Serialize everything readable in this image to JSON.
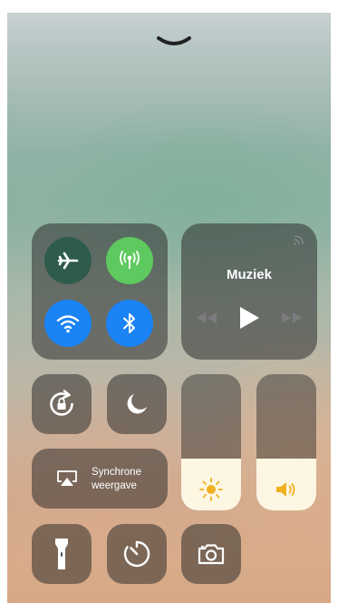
{
  "music": {
    "title": "Muziek"
  },
  "screen_mirroring": {
    "line1": "Synchrone",
    "line2": "weergave"
  },
  "brightness": {
    "level": 0.38
  },
  "volume": {
    "level": 0.38
  },
  "colors": {
    "cellular_active": "#5ec95f",
    "wifi_active": "#1a83f6",
    "bluetooth_active": "#1a83f6",
    "airplane_inactive": "#2f5b4c",
    "slider_fill": "#fdf6e2"
  },
  "icons": {
    "close": "chevron-down-icon",
    "airplane": "airplane-icon",
    "cellular": "antenna-icon",
    "wifi": "wifi-icon",
    "bluetooth": "bluetooth-icon",
    "airplay_audio": "airplay-audio-icon",
    "previous": "rewind-icon",
    "play": "play-icon",
    "next": "fast-forward-icon",
    "rotation_lock": "rotation-lock-icon",
    "do_not_disturb": "moon-icon",
    "screen_mirroring": "screen-mirroring-icon",
    "brightness": "sun-icon",
    "volume": "speaker-icon",
    "flashlight": "flashlight-icon",
    "timer": "timer-icon",
    "camera": "camera-icon"
  }
}
